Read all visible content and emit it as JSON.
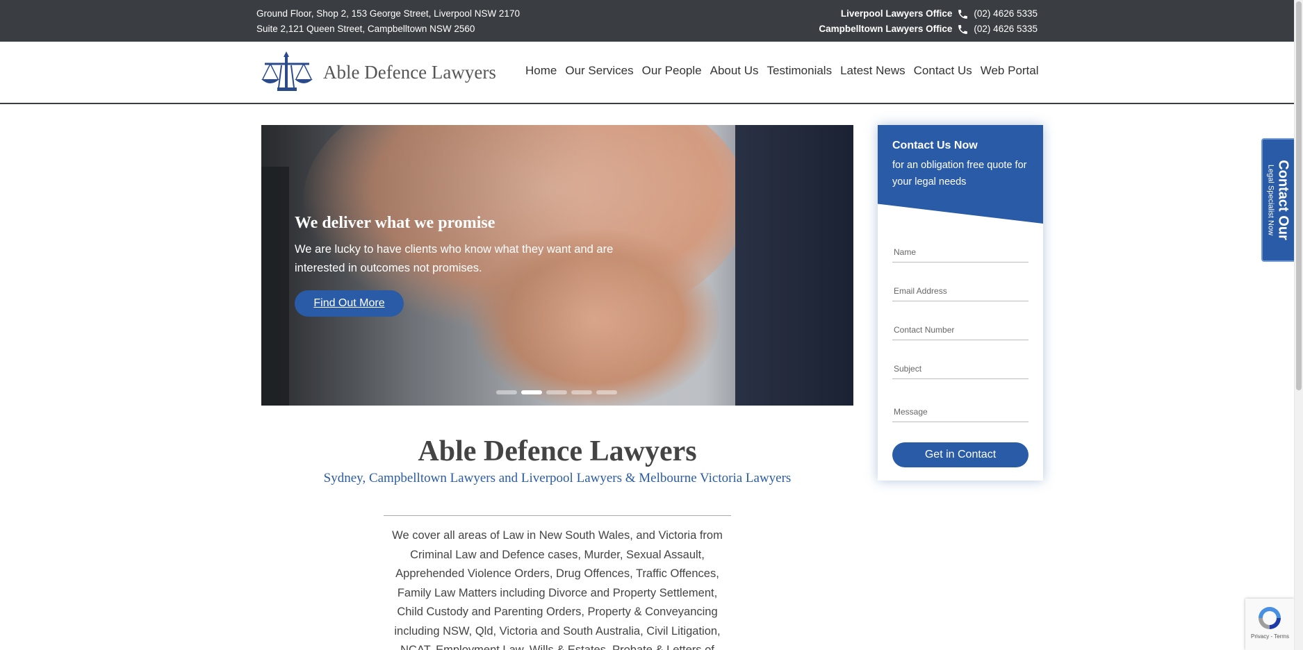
{
  "topbar": {
    "address_1": "Ground Floor, Shop 2, 153 George Street, Liverpool NSW 2170",
    "address_2": "Suite 2,121 Queen Street, Campbelltown NSW 2560",
    "office_1": "Liverpool Lawyers Office",
    "phone_1": "(02) 4626 5335",
    "office_2": "Campbelltown Lawyers Office",
    "phone_2": "(02) 4626 5335"
  },
  "header": {
    "logo_text": "Able Defence Lawyers",
    "nav": [
      "Home",
      "Our Services",
      "Our People",
      "About Us",
      "Testimonials",
      "Latest News",
      "Contact Us",
      "Web Portal"
    ]
  },
  "hero": {
    "title": "We deliver what we promise",
    "text": "We are lucky to have clients who know what they want and are interested in outcomes not promises.",
    "button": "Find Out More",
    "slides": 5,
    "active_slide": 2
  },
  "contact_form": {
    "heading": "Contact Us Now",
    "subheading": "for an obligation free quote for your legal needs",
    "fields": {
      "name": "Name",
      "email": "Email Address",
      "phone": "Contact Number",
      "subject": "Subject",
      "message": "Message"
    },
    "submit": "Get in Contact"
  },
  "side_tab": {
    "line1": "Contact Our",
    "line2": "Legal Specialist Now"
  },
  "main": {
    "title": "Able Defence Lawyers",
    "subtitle": "Sydney, Campbelltown Lawyers and Liverpool Lawyers & Melbourne Victoria Lawyers",
    "body": "We cover all areas of Law in New South Wales, and Victoria  from Criminal Law and Defence cases, Murder, Sexual Assault, Apprehended Violence Orders, Drug Offences, Traffic Offences, Family Law Matters including Divorce and Property Settlement, Child Custody and Parenting Orders, Property & Conveyancing including NSW, Qld, Victoria and South Australia, Civil Litigation, NCAT, Employment Law, Wills & Estates, Probate & Letters of"
  },
  "recaptcha": {
    "text": "Privacy - Terms"
  },
  "colors": {
    "brand_blue": "#2a5ba7",
    "topbar_bg": "#3a3d42"
  }
}
